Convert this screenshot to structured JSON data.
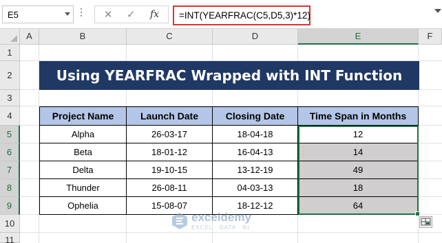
{
  "name_box": "E5",
  "formula": "=INT(YEARFRAC(C5,D5,3)*12)",
  "formula_buttons": {
    "cancel": "✕",
    "enter": "✓",
    "fx": "fx"
  },
  "columns": [
    "A",
    "B",
    "C",
    "D",
    "E",
    "F"
  ],
  "selected_column": "E",
  "rows": [
    "1",
    "2",
    "3",
    "4",
    "5",
    "6",
    "7",
    "8",
    "9",
    "10",
    "11"
  ],
  "selected_rows": [
    "5",
    "6",
    "7",
    "8",
    "9"
  ],
  "title": "Using YEARFRAC Wrapped with INT Function",
  "table": {
    "headers": [
      "Project Name",
      "Launch Date",
      "Closing Date",
      "Time Span in Months"
    ],
    "rows": [
      [
        "Alpha",
        "26-03-17",
        "18-04-18",
        "12"
      ],
      [
        "Beta",
        "18-01-12",
        "16-04-13",
        "14"
      ],
      [
        "Delta",
        "19-10-15",
        "13-12-19",
        "49"
      ],
      [
        "Thunder",
        "26-08-11",
        "04-03-13",
        "18"
      ],
      [
        "Ophelia",
        "15-08-07",
        "18-12-12",
        "64"
      ]
    ]
  },
  "watermark": {
    "name": "exceldemy",
    "tagline": "EXCEL · DATA · BI"
  },
  "colors": {
    "title_bg": "#203864",
    "header_bg": "#b4c6e7",
    "shaded_cell": "#d0cece",
    "selection": "#1e7145",
    "formula_highlight": "#e0302e"
  }
}
